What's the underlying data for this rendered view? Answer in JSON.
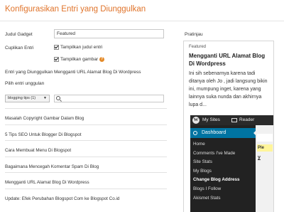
{
  "header": {
    "title": "Konfigurasikan Entri yang Diunggulkan"
  },
  "form": {
    "gadget_title_label": "Judul Gadget",
    "gadget_title_value": "Featured",
    "cuplikan_label": "Cuplikan Entri",
    "show_snippet_label": "Tampilkan judul entri",
    "show_image_label": "Tampilkan gambar",
    "help_glyph": "?",
    "featured_entry_text": "Entri yang Diunggulkan Mengganti URL Alamat Blog Di Wordpress",
    "choose_label": "Pilih entri unggulan",
    "blog_select_value": "blogging tips (1)",
    "search_placeholder": ""
  },
  "posts": [
    "Masalah Copyright Gambar Dalam Blog",
    "5 Tips SEO Untuk Blogger Di Blogspot",
    "Cara Membuat Menu Di Blogspot",
    "Bagaimana Mencegah Komentar Spam Di Blog",
    "Mengganti URL Alamat Blog Di Wordpress",
    "Update: Efek Perubahan Blogspot Com ke Blogspot Co.id"
  ],
  "preview": {
    "label": "Pratinjau",
    "header": "Featured",
    "title": "Mengganti URL Alamat Blog Di Wordpress",
    "body": "Ini sih sebenarnya karena tadi ditanya oleh Jo , jadi langsung bikin ini, mumpung inget, karena yang lainnya suka nunda dan akhirnya lupa d...",
    "wp": {
      "logo": "W",
      "my_sites": "My Sites",
      "reader": "Reader",
      "dashboard": "Dashboard",
      "menu": [
        "Home",
        "Comments I've Made",
        "Site Stats",
        "My Blogs",
        "Change Blog Address",
        "Blogs I Follow",
        "Akismet Stats"
      ],
      "active_index": 4,
      "highlight_text": "Ple",
      "side_text": "y"
    }
  },
  "colors": {
    "title": "#e0742b",
    "wp_blue": "#0074a2",
    "wp_dark": "#222222",
    "help": "#e48b2a"
  }
}
